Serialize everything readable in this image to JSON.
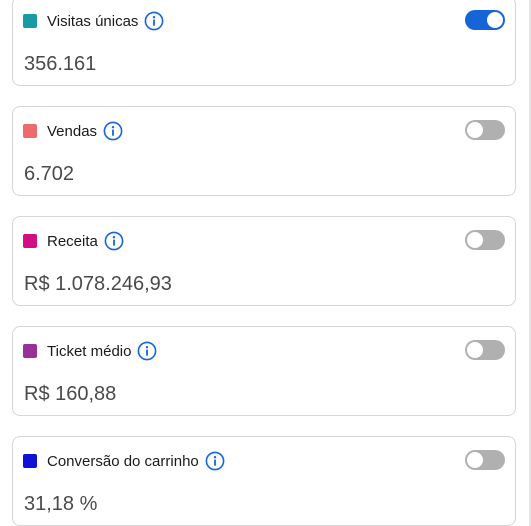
{
  "metrics": [
    {
      "label": "Visitas únicas",
      "value": "356.161",
      "color": "#1a9aa5",
      "enabled": true,
      "info_icon": "info-circle-icon"
    },
    {
      "label": "Vendas",
      "value": "6.702",
      "color": "#ef6b6b",
      "enabled": false,
      "info_icon": "info-circle-icon"
    },
    {
      "label": "Receita",
      "value": "R$ 1.078.246,93",
      "color": "#d10f85",
      "enabled": false,
      "info_icon": "info-circle-icon"
    },
    {
      "label": "Ticket médio",
      "value": "R$ 160,88",
      "color": "#9a2f98",
      "enabled": false,
      "info_icon": "info-circle-icon"
    },
    {
      "label": "Conversão do carrinho",
      "value": "31,18 %",
      "color": "#1111d6",
      "enabled": false,
      "info_icon": "info-circle-icon"
    }
  ],
  "colors": {
    "toggle_on": "#1565d8",
    "toggle_off": "#b0b0b0",
    "info_icon": "#1565d8",
    "card_border": "#d6d6d6"
  }
}
